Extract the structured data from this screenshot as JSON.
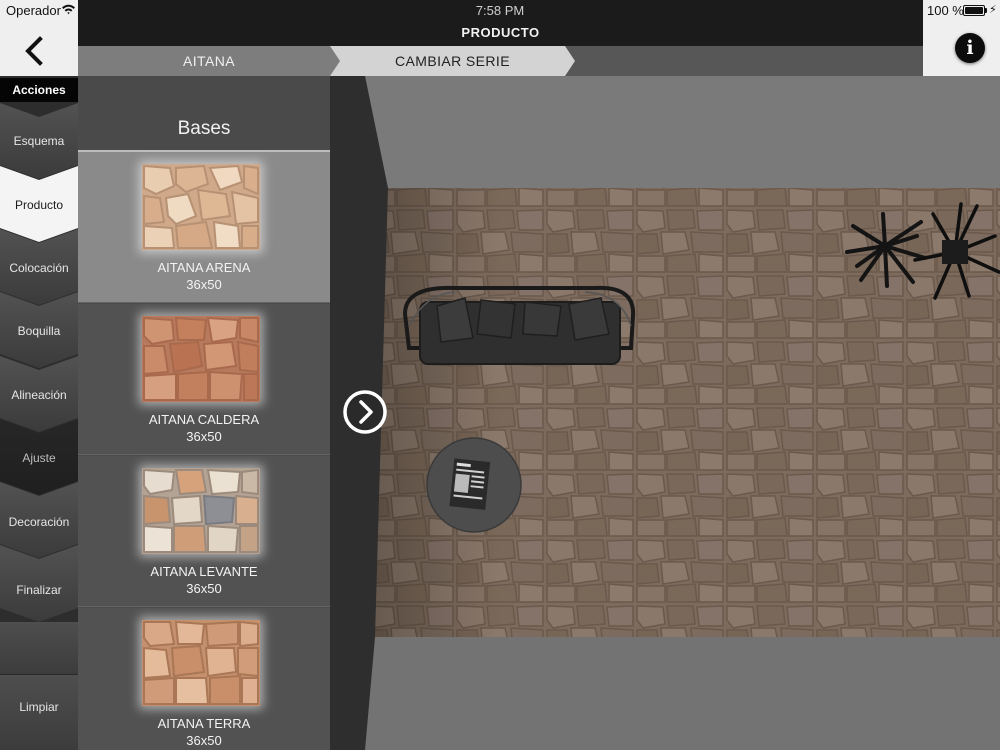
{
  "status_bar": {
    "carrier": "Operador",
    "time": "7:58 PM",
    "battery": "100 %"
  },
  "header": {
    "title": "PRODUCTO"
  },
  "breadcrumb": {
    "items": [
      "AITANA",
      "CAMBIAR SERIE"
    ]
  },
  "actions": {
    "header": "Acciones",
    "items": [
      {
        "label": "Esquema"
      },
      {
        "label": "Producto"
      },
      {
        "label": "Colocación"
      },
      {
        "label": "Boquilla"
      },
      {
        "label": "Alineación"
      },
      {
        "label": "Ajuste"
      },
      {
        "label": "Decoración"
      },
      {
        "label": "Finalizar"
      },
      {
        "label": "Limpiar"
      }
    ]
  },
  "products": {
    "title": "Bases",
    "items": [
      {
        "name": "AITANA ARENA",
        "size": "36x50"
      },
      {
        "name": "AITANA CALDERA",
        "size": "36x50"
      },
      {
        "name": "AITANA LEVANTE",
        "size": "36x50"
      },
      {
        "name": "AITANA TERRA",
        "size": "36x50"
      }
    ]
  },
  "icons": {
    "back": "chevron-left-icon",
    "info": "info-icon",
    "next": "chevron-right-circle-icon",
    "wifi": "wifi-icon",
    "battery": "battery-icon"
  },
  "colors": {
    "header_dark": "#1b1b1b",
    "active_action": "#f4f4f4",
    "panel_bg": "#4a4a4a",
    "floor_tile": "#7a6a5c"
  }
}
